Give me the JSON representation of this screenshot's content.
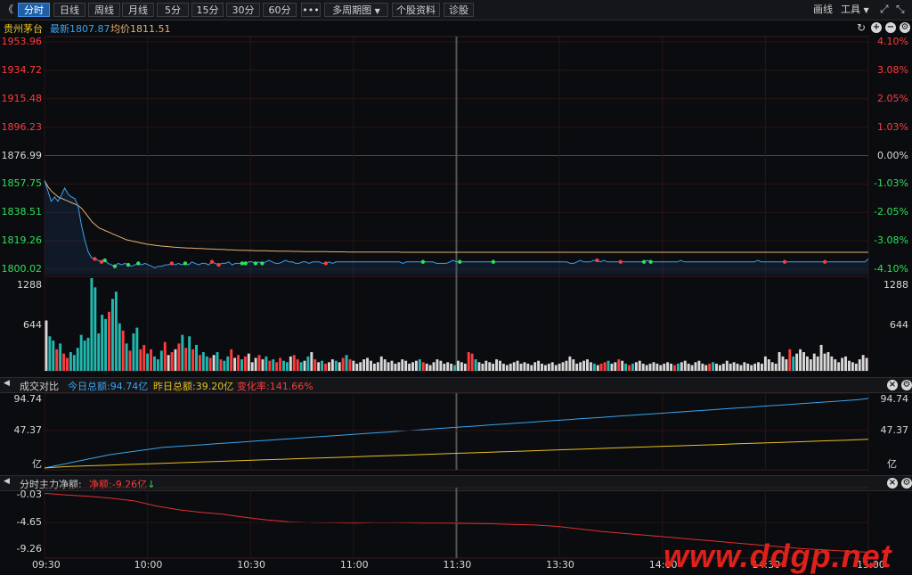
{
  "toolbar": {
    "back_glyph": "《",
    "periods": [
      "分时",
      "日线",
      "周线",
      "月线",
      "5分",
      "15分",
      "30分",
      "60分"
    ],
    "more_label": "•••",
    "multi_period_label": "多周期图",
    "stock_info_label": "个股资料",
    "diagnose_label": "诊股",
    "draw_label": "画线",
    "tools_label": "工具",
    "tools_arrow": "▼",
    "active_index": 0
  },
  "stock": {
    "name": "贵州茅台",
    "latest_label": "最新",
    "latest_value": "1807.87",
    "avg_label": "均价",
    "avg_value": "1811.51"
  },
  "price_axis": {
    "left": [
      "1953.96",
      "1934.72",
      "1915.48",
      "1896.23",
      "1876.99",
      "1857.75",
      "1838.51",
      "1819.26",
      "1800.02"
    ],
    "right": [
      "4.10%",
      "3.08%",
      "2.05%",
      "1.03%",
      "0.00%",
      "-1.03%",
      "-2.05%",
      "-3.08%",
      "-4.10%"
    ]
  },
  "volume_axis": {
    "max": "1288",
    "mid": "644"
  },
  "turnover_panel": {
    "title": "成交对比",
    "today_label": "今日总额:",
    "today_value": "94.74亿",
    "yesterday_label": "昨日总额:",
    "yesterday_value": "39.20亿",
    "change_label": "变化率:",
    "change_value": "141.66%",
    "axis": [
      "94.74",
      "47.37",
      "亿"
    ]
  },
  "money_panel": {
    "title": "分时主力净额:",
    "net_label": "净额:",
    "net_value": "-9.26亿",
    "net_arrow": "↓",
    "axis": [
      "-0.03",
      "-4.65",
      "-9.26"
    ]
  },
  "time_axis": [
    "09:30",
    "10:00",
    "10:30",
    "11:00",
    "11:30",
    "13:30",
    "14:00",
    "14:30",
    "15:00"
  ],
  "watermark": "www.ddgp.net",
  "colors": {
    "up": "#ff3b3b",
    "down": "#2ee05a",
    "price_line": "#3aa3f0",
    "avg_line": "#e8b070",
    "today_line": "#3aa3f0",
    "yesterday_line": "#e8c020",
    "money_line": "#e03030",
    "flat": "#d8d8d8"
  },
  "chart_data": [
    {
      "type": "line",
      "name": "price",
      "x_range": [
        0,
        240
      ],
      "ylim": [
        1800.02,
        1953.96
      ],
      "series": [
        {
          "name": "最新",
          "values": [
            1860,
            1853,
            1846,
            1849,
            1846,
            1850,
            1855,
            1851,
            1849,
            1848,
            1843,
            1830,
            1820,
            1812,
            1808,
            1807,
            1806,
            1805,
            1806,
            1804,
            1803,
            1802,
            1804,
            1803,
            1804,
            1803,
            1802,
            1803,
            1804,
            1803,
            1804,
            1803,
            1802,
            1801,
            1802,
            1802,
            1803,
            1803,
            1804,
            1803,
            1804,
            1803,
            1804,
            1803,
            1805,
            1804,
            1803,
            1804,
            1804,
            1803,
            1805,
            1804,
            1803,
            1804,
            1804,
            1805,
            1803,
            1804,
            1804,
            1804,
            1804,
            1805,
            1805,
            1804,
            1805,
            1804,
            1805,
            1806,
            1805,
            1804,
            1804,
            1805,
            1806,
            1805,
            1805,
            1804,
            1804,
            1805,
            1805,
            1804,
            1805,
            1805,
            1805,
            1804,
            1804,
            1805,
            1804,
            1805,
            1805,
            1805,
            1805,
            1805,
            1805,
            1805,
            1805,
            1805,
            1805,
            1805,
            1805,
            1805,
            1805,
            1805,
            1805,
            1805,
            1805,
            1805,
            1805,
            1804,
            1805,
            1805,
            1805,
            1805,
            1805,
            1805,
            1805,
            1805,
            1805,
            1804,
            1804,
            1804,
            1804,
            1805,
            1806,
            1805,
            1805,
            1805,
            1805,
            1805,
            1805,
            1805,
            1805,
            1805,
            1805,
            1805,
            1805,
            1805,
            1805,
            1805,
            1805,
            1805,
            1805,
            1805,
            1805,
            1805,
            1805,
            1805,
            1805,
            1805,
            1805,
            1805,
            1805,
            1805,
            1805,
            1805,
            1805,
            1805,
            1805,
            1804,
            1804,
            1805,
            1806,
            1805,
            1805,
            1805,
            1806,
            1806,
            1805,
            1806,
            1805,
            1805,
            1805,
            1805,
            1805,
            1805,
            1805,
            1805,
            1805,
            1805,
            1805,
            1805,
            1806,
            1805,
            1805,
            1805,
            1805,
            1805,
            1805,
            1805,
            1805,
            1805,
            1806,
            1805,
            1805,
            1805,
            1805,
            1805,
            1805,
            1805,
            1805,
            1805,
            1805,
            1805,
            1805,
            1805,
            1805,
            1805,
            1805,
            1805,
            1805,
            1805,
            1805,
            1805,
            1805,
            1806,
            1805,
            1805,
            1805,
            1805,
            1805,
            1805,
            1805,
            1805,
            1805,
            1805,
            1805,
            1805,
            1805,
            1805,
            1805,
            1805,
            1805,
            1805,
            1805,
            1805,
            1805,
            1805,
            1805,
            1805,
            1805,
            1805,
            1805,
            1805,
            1805,
            1805,
            1805,
            1805,
            1807
          ]
        },
        {
          "name": "均价",
          "values": [
            1860,
            1856,
            1853,
            1851,
            1849,
            1848,
            1847,
            1846,
            1845,
            1844,
            1843,
            1841,
            1838,
            1835,
            1832,
            1830,
            1828,
            1827,
            1826,
            1825,
            1824,
            1823,
            1822,
            1821,
            1820,
            1819.5,
            1819,
            1818.5,
            1818,
            1817.5,
            1817,
            1816.7,
            1816.4,
            1816.1,
            1815.8,
            1815.6,
            1815.4,
            1815.2,
            1815,
            1814.8,
            1814.6,
            1814.5,
            1814.4,
            1814.3,
            1814.2,
            1814.1,
            1814,
            1813.9,
            1813.8,
            1813.7,
            1813.6,
            1813.5,
            1813.4,
            1813.3,
            1813.2,
            1813.1,
            1813,
            1812.9,
            1812.8,
            1812.8,
            1812.7,
            1812.7,
            1812.6,
            1812.6,
            1812.5,
            1812.5,
            1812.4,
            1812.4,
            1812.3,
            1812.3,
            1812.2,
            1812.2,
            1812.2,
            1812.1,
            1812.1,
            1812.1,
            1812,
            1812,
            1812,
            1812,
            1811.9,
            1811.9,
            1811.9,
            1811.9,
            1811.8,
            1811.8,
            1811.8,
            1811.8,
            1811.8,
            1811.7,
            1811.7,
            1811.7,
            1811.7,
            1811.7,
            1811.7,
            1811.6,
            1811.6,
            1811.6,
            1811.6,
            1811.6,
            1811.6,
            1811.6,
            1811.6,
            1811.6,
            1811.6,
            1811.5,
            1811.5,
            1811.5,
            1811.5,
            1811.5,
            1811.5,
            1811.5,
            1811.5,
            1811.5,
            1811.5,
            1811.5,
            1811.5,
            1811.5,
            1811.5,
            1811.5,
            1811.5,
            1811.5,
            1811.5,
            1811.5,
            1811.5,
            1811.5,
            1811.5,
            1811.5,
            1811.5,
            1811.5,
            1811.5,
            1811.5,
            1811.5,
            1811.5,
            1811.5,
            1811.5,
            1811.5,
            1811.5,
            1811.5,
            1811.5,
            1811.5,
            1811.5,
            1811.5,
            1811.5,
            1811.5,
            1811.5,
            1811.5,
            1811.5,
            1811.5,
            1811.5,
            1811.5,
            1811.5,
            1811.5,
            1811.5,
            1811.5,
            1811.5,
            1811.5,
            1811.5,
            1811.5,
            1811.5,
            1811.5,
            1811.5,
            1811.5,
            1811.5,
            1811.5,
            1811.5,
            1811.5,
            1811.5,
            1811.5,
            1811.5,
            1811.5,
            1811.5,
            1811.5,
            1811.5,
            1811.5,
            1811.5,
            1811.5,
            1811.5,
            1811.5,
            1811.5,
            1811.5,
            1811.5,
            1811.5,
            1811.5,
            1811.5,
            1811.5,
            1811.5,
            1811.5,
            1811.5,
            1811.5,
            1811.5,
            1811.5,
            1811.5,
            1811.5,
            1811.5,
            1811.5,
            1811.5,
            1811.5,
            1811.5,
            1811.5,
            1811.5,
            1811.5,
            1811.5,
            1811.5,
            1811.5,
            1811.5,
            1811.5,
            1811.5,
            1811.5,
            1811.5,
            1811.5,
            1811.5,
            1811.5,
            1811.5,
            1811.5,
            1811.5,
            1811.5,
            1811.5,
            1811.5,
            1811.5,
            1811.5,
            1811.5,
            1811.5,
            1811.5,
            1811.5,
            1811.5,
            1811.5,
            1811.5,
            1811.5,
            1811.5,
            1811.5,
            1811.5,
            1811.5,
            1811.5,
            1811.5,
            1811.5,
            1811.5,
            1811.5,
            1811.5,
            1811.5,
            1811.5,
            1811.5,
            1811.51
          ]
        }
      ],
      "up_markers": [
        15,
        17,
        38,
        52,
        50,
        84,
        172,
        165,
        221,
        233
      ],
      "down_markers": [
        18,
        21,
        25,
        28,
        42,
        59,
        60,
        63,
        65,
        113,
        124,
        134,
        179,
        181
      ]
    },
    {
      "type": "bar",
      "name": "volume",
      "ylim": [
        0,
        1288
      ],
      "values": [
        700,
        480,
        420,
        300,
        380,
        240,
        180,
        260,
        220,
        320,
        500,
        420,
        460,
        1288,
        1160,
        520,
        780,
        720,
        820,
        1000,
        1100,
        660,
        560,
        380,
        280,
        520,
        600,
        300,
        360,
        240,
        300,
        200,
        160,
        280,
        400,
        220,
        260,
        300,
        380,
        500,
        320,
        480,
        300,
        360,
        220,
        260,
        200,
        180,
        220,
        260,
        160,
        140,
        200,
        300,
        180,
        220,
        160,
        200,
        240,
        120,
        180,
        220,
        160,
        200,
        140,
        160,
        120,
        180,
        140,
        120,
        200,
        220,
        160,
        120,
        140,
        200,
        260,
        160,
        120,
        140,
        100,
        120,
        160,
        140,
        120,
        180,
        220,
        160,
        140,
        100,
        120,
        160,
        180,
        140,
        100,
        120,
        200,
        160,
        120,
        140,
        100,
        120,
        160,
        140,
        100,
        120,
        140,
        160,
        120,
        100,
        80,
        120,
        160,
        140,
        100,
        120,
        100,
        80,
        140,
        120,
        100,
        260,
        240,
        160,
        120,
        100,
        140,
        120,
        100,
        160,
        140,
        100,
        80,
        100,
        120,
        140,
        100,
        120,
        100,
        80,
        120,
        140,
        100,
        80,
        100,
        120,
        80,
        100,
        120,
        140,
        200,
        160,
        100,
        120,
        140,
        160,
        120,
        100,
        80,
        100,
        120,
        140,
        100,
        120,
        160,
        140,
        100,
        80,
        100,
        120,
        140,
        100,
        80,
        100,
        120,
        100,
        80,
        100,
        120,
        100,
        80,
        100,
        120,
        140,
        100,
        80,
        120,
        140,
        100,
        80,
        100,
        120,
        100,
        80,
        100,
        140,
        100,
        120,
        100,
        80,
        120,
        100,
        80,
        100,
        120,
        100,
        200,
        160,
        120,
        100,
        260,
        200,
        160,
        300,
        200,
        240,
        300,
        260,
        200,
        160,
        240,
        200,
        360,
        240,
        260,
        200,
        160,
        120,
        180,
        200,
        140,
        120,
        100,
        160,
        220,
        180
      ],
      "colors": "up/down/flat per bar"
    },
    {
      "type": "line",
      "name": "turnover",
      "ylim": [
        0,
        94.74
      ],
      "series": [
        {
          "name": "今日总额",
          "values": [
            0,
            3,
            6,
            9,
            12,
            15,
            18,
            20,
            22,
            24,
            26,
            28,
            29,
            30,
            31,
            32,
            33,
            34,
            35,
            36,
            37,
            38,
            39,
            40,
            41,
            42,
            43,
            44,
            45,
            46,
            47,
            48,
            49,
            50,
            51,
            52,
            53,
            54,
            55,
            56,
            57,
            58,
            59,
            60,
            61,
            62,
            63,
            64,
            65,
            66,
            67,
            68,
            69,
            70,
            71,
            72,
            73,
            74,
            75,
            76,
            77,
            78,
            79,
            80,
            81,
            82,
            83,
            84,
            85,
            86,
            87,
            88,
            89,
            90,
            91,
            92,
            93,
            94.74
          ]
        },
        {
          "name": "昨日总额",
          "values": [
            0,
            2,
            3,
            4,
            5,
            6,
            7,
            8,
            9,
            10,
            11,
            12,
            13,
            14,
            15,
            16,
            17,
            18,
            19,
            20,
            21,
            22,
            23,
            24,
            25,
            26,
            27,
            28,
            29,
            30,
            31,
            32,
            33,
            34,
            35,
            36,
            37,
            38,
            39.2
          ]
        }
      ]
    },
    {
      "type": "line",
      "name": "main_net",
      "ylim": [
        -9.9,
        0.3
      ],
      "series": [
        {
          "name": "净额",
          "values": [
            -0.03,
            -0.3,
            -0.5,
            -0.8,
            -1.2,
            -2.0,
            -2.6,
            -3.0,
            -3.3,
            -3.8,
            -4.2,
            -4.5,
            -4.6,
            -4.65,
            -4.7,
            -4.6,
            -4.65,
            -4.7,
            -4.7,
            -4.75,
            -4.8,
            -4.9,
            -5.0,
            -5.2,
            -5.6,
            -6.0,
            -6.3,
            -6.6,
            -6.9,
            -7.2,
            -7.5,
            -7.8,
            -8.1,
            -8.4,
            -8.7,
            -8.9,
            -9.1,
            -9.26
          ]
        }
      ]
    }
  ]
}
